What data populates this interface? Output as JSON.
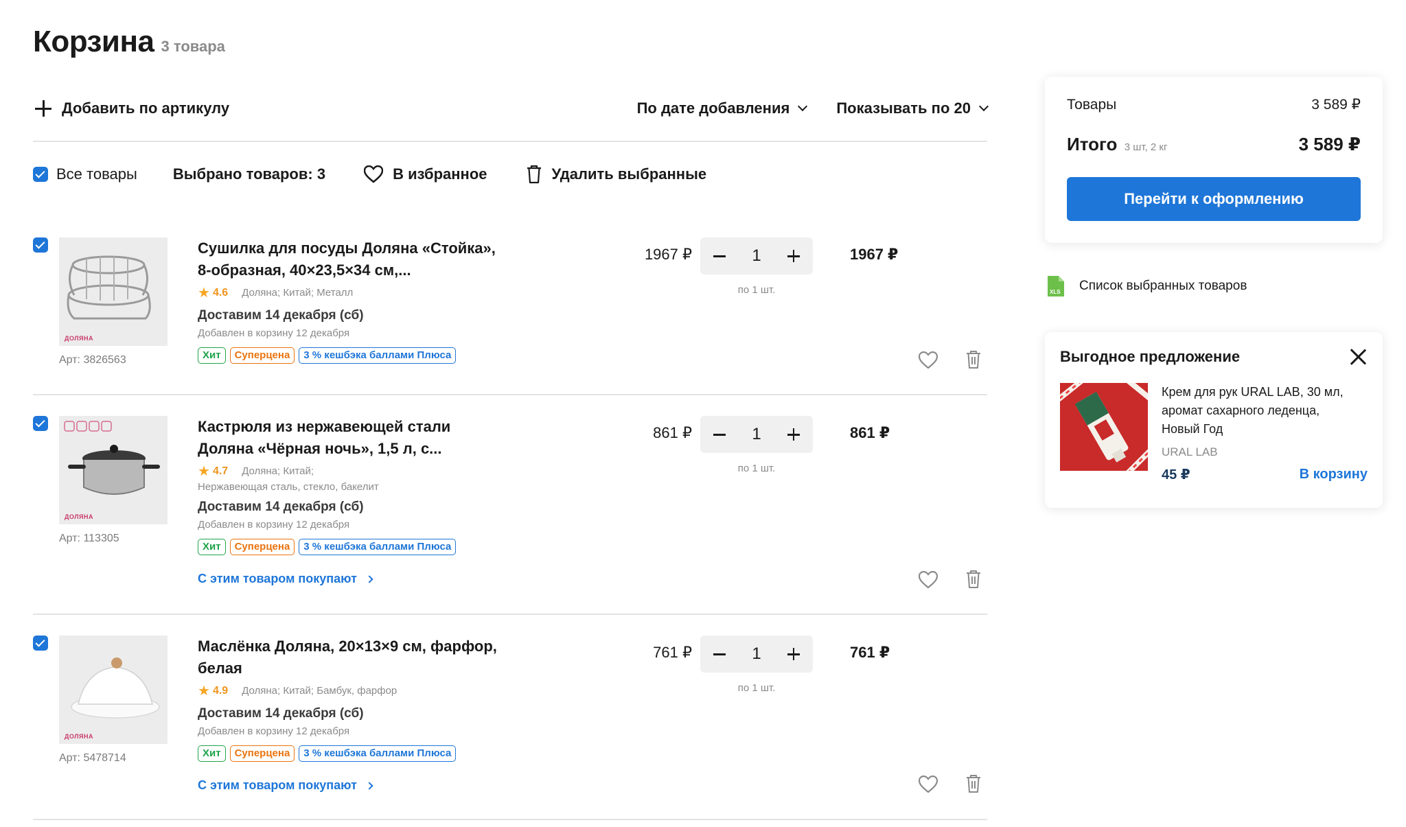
{
  "header": {
    "title": "Корзина",
    "count": "3 товара"
  },
  "toolbar": {
    "add_by_article": "Добавить по артикулу",
    "sort_label": "По дате добавления",
    "page_size_label": "Показывать по 20"
  },
  "selection": {
    "all_label": "Все товары",
    "selected_count": "Выбрано товаров: 3",
    "to_favorites": "В избранное",
    "delete_selected": "Удалить выбранные"
  },
  "items": [
    {
      "title_line1": "Сушилка для посуды Доляна «Стойка»,",
      "title_line2": "8-образная, 40×23,5×34 см,...",
      "rating": "4.6",
      "meta": "Доляна; Китай; Металл",
      "meta2": "",
      "delivery": "Доставим 14 декабря (сб)",
      "added": "Добавлен в корзину 12 декабря",
      "article": "Арт: 3826563",
      "brand_mark": "ДОЛЯНА",
      "badges": [
        "Хит",
        "Суперцена",
        "3 % кешбэка баллами Плюса"
      ],
      "also_buy": "",
      "price": "1967 ₽",
      "qty": "1",
      "per": "по 1 шт.",
      "total": "1967 ₽"
    },
    {
      "title_line1": "Кастрюля из нержавеющей стали",
      "title_line2": "Доляна «Чёрная ночь», 1,5 л, с...",
      "rating": "4.7",
      "meta": "Доляна; Китай;",
      "meta2": "Нержавеющая сталь, стекло, бакелит",
      "delivery": "Доставим 14 декабря (сб)",
      "added": "Добавлен в корзину 12 декабря",
      "article": "Арт: 113305",
      "brand_mark": "ДОЛЯНА",
      "badges": [
        "Хит",
        "Суперцена",
        "3 % кешбэка баллами Плюса"
      ],
      "also_buy": "С этим товаром покупают",
      "price": "861 ₽",
      "qty": "1",
      "per": "по 1 шт.",
      "total": "861 ₽"
    },
    {
      "title_line1": "Маслёнка Доляна, 20×13×9 см, фарфор,",
      "title_line2": "белая",
      "rating": "4.9",
      "meta": "Доляна; Китай; Бамбук, фарфор",
      "meta2": "",
      "delivery": "Доставим 14 декабря (сб)",
      "added": "Добавлен в корзину 12 декабря",
      "article": "Арт: 5478714",
      "brand_mark": "ДОЛЯНА",
      "badges": [
        "Хит",
        "Суперцена",
        "3 % кешбэка баллами Плюса"
      ],
      "also_buy": "С этим товаром покупают",
      "price": "761 ₽",
      "qty": "1",
      "per": "по 1 шт.",
      "total": "761 ₽"
    }
  ],
  "summary": {
    "goods_label": "Товары",
    "goods_value": "3 589 ₽",
    "total_label": "Итого",
    "total_sub": "3 шт, 2 кг",
    "total_value": "3 589 ₽",
    "checkout_label": "Перейти к оформлению"
  },
  "export": {
    "label": "Список выбранных товаров",
    "icon_text": "XLS"
  },
  "offer": {
    "title": "Выгодное предложение",
    "name_line1": "Крем для рук URAL LAB, 30 мл,",
    "name_line2": "аромат сахарного леденца,",
    "name_line3": "Новый Год",
    "brand": "URAL LAB",
    "price": "45 ₽",
    "cart_label": "В корзину"
  },
  "colors": {
    "accent": "#1e76d8",
    "hit": "#1fa34a",
    "super": "#e9740f",
    "rating": "#f0951f"
  }
}
